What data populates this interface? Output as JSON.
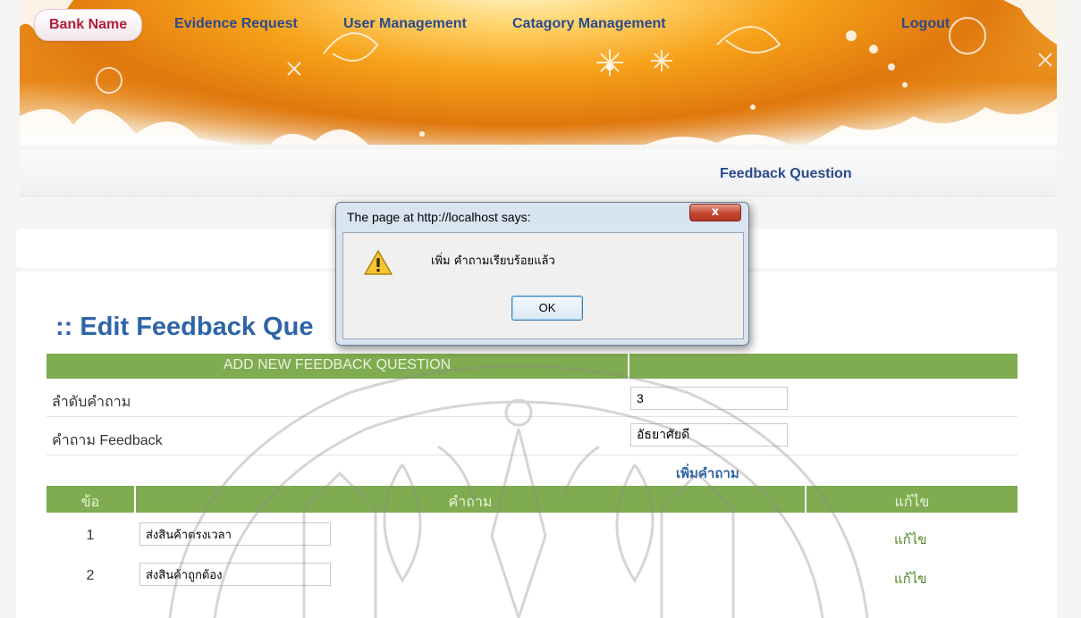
{
  "nav": {
    "items": [
      {
        "label": "Bank Name"
      },
      {
        "label": "Evidence Request"
      },
      {
        "label": "User Management"
      },
      {
        "label": "Catagory Management"
      },
      {
        "label": "Feedback Question"
      },
      {
        "label": "Logout"
      }
    ],
    "active": "Bank Name",
    "active_color": "#b21e3c",
    "link_color": "#2b4a8c"
  },
  "page": {
    "title": ":: Edit Feedback Que",
    "add_header": "ADD NEW FEEDBACK QUESTION",
    "header_color": "#7fac50"
  },
  "form": {
    "order_label": "ลำดับคำถาม",
    "order_value": "3",
    "question_label": "คำถาม Feedback",
    "question_value": "อัธยาศัยดี",
    "add_link": "เพิ่มคำถาม"
  },
  "table": {
    "headers": {
      "no": "ข้อ",
      "question": "คำถาม",
      "edit": "แก้ไข"
    },
    "rows": [
      {
        "no": "1",
        "question": "ส่งสินค้าตรงเวลา",
        "edit": "แก้ไข"
      },
      {
        "no": "2",
        "question": "ส่งสินค้าถูกต้อง",
        "edit": "แก้ไข"
      }
    ]
  },
  "dialog": {
    "title": "The page at http://localhost says:",
    "message": "เพิ่ม คำถามเรียบร้อยแล้ว",
    "ok_label": "OK",
    "close_label": "x",
    "icon": "warning-icon"
  }
}
